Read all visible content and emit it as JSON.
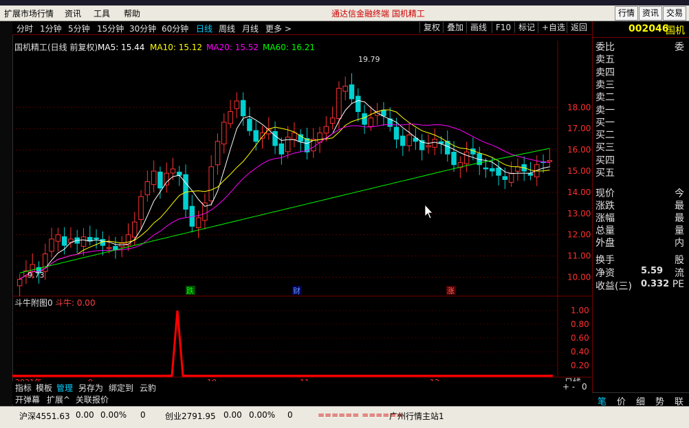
{
  "menu": {
    "items": [
      "扩展市场行情",
      "资讯",
      "工具",
      "帮助"
    ],
    "center_title": "通达信金融终端   国机精工",
    "right_buttons": [
      "行情",
      "资讯",
      "交易"
    ]
  },
  "toolbar": {
    "periods": [
      "分时",
      "1分钟",
      "5分钟",
      "15分钟",
      "30分钟",
      "60分钟",
      "日线",
      "周线",
      "月线",
      "更多 >"
    ],
    "active": "日线",
    "right_buttons": [
      "复权",
      "叠加",
      "画线",
      "F10",
      "标记",
      "+自选",
      "返回"
    ]
  },
  "legend": {
    "name": "国机精工(日线 前复权)",
    "ma5": "MA5: 15.44",
    "ma10": "MA10: 15.12",
    "ma20": "MA20: 15.52",
    "ma60": "MA60: 16.21",
    "colors": {
      "ma5": "#ffffff",
      "ma10": "#ffff00",
      "ma20": "#ff00ff",
      "ma60": "#00ff00"
    }
  },
  "price_axis": [
    "18.00",
    "17.00",
    "16.00",
    "15.00",
    "14.00",
    "13.00",
    "12.00",
    "11.00",
    "10.00"
  ],
  "annotations": {
    "high": "19.79",
    "low": "9.73",
    "markers": [
      "跌",
      "财",
      "涨"
    ]
  },
  "sub_chart": {
    "title": "斗牛附图0",
    "label": "斗牛: 0.00",
    "axis": [
      "1.00",
      "0.80",
      "0.60",
      "0.40",
      "0.20"
    ]
  },
  "date_axis": [
    "2021年",
    "9",
    "10",
    "11",
    "12"
  ],
  "period_label": "日线",
  "bottom_tabs": [
    "指标",
    "模板",
    "管理",
    "另存为",
    "绑定到",
    "云豹"
  ],
  "bottom_tabs2": [
    "开弹幕",
    "扩展^",
    "关联报价"
  ],
  "right_panel": {
    "code": "002046",
    "name": "国机",
    "rows_top": [
      "委比",
      "卖五",
      "卖四",
      "卖三",
      "卖二",
      "卖一",
      "买一",
      "买二",
      "买三",
      "买四",
      "买五"
    ],
    "rows_top_right": [
      "委"
    ],
    "rows_mid": [
      "现价",
      "涨跌",
      "涨幅",
      "总量",
      "外盘"
    ],
    "rows_mid_right": [
      "今",
      "最",
      "最",
      "量",
      "内"
    ],
    "rows_bot": [
      "换手",
      "净资",
      "收益(三)"
    ],
    "rows_bot_vals": [
      "",
      "5.59",
      "0.332"
    ],
    "rows_bot_right": [
      "股",
      "流",
      "PE"
    ],
    "tabs": [
      "笔",
      "价",
      "细",
      "势",
      "联"
    ]
  },
  "status": {
    "sh": "沪深4551.63",
    "sh_chg": "0.00",
    "sh_pct": "0.00%",
    "sh_vol": "0",
    "cy": "创业2791.95",
    "cy_chg": "0.00",
    "cy_pct": "0.00%",
    "cy_vol": "0",
    "bar": "====== ======",
    "station": "广州行情主站1"
  },
  "chart_data": {
    "type": "candlestick",
    "ylim": [
      9.5,
      20.5
    ],
    "closes": [
      9.9,
      10.3,
      10.6,
      10.2,
      11.1,
      11.8,
      12.0,
      11.5,
      11.8,
      11.6,
      11.9,
      11.7,
      11.8,
      11.5,
      11.4,
      11.3,
      11.6,
      12.0,
      12.6,
      13.8,
      14.5,
      15.0,
      14.2,
      14.9,
      15.1,
      14.8,
      13.2,
      12.4,
      12.8,
      13.5,
      15.2,
      16.4,
      17.3,
      17.8,
      18.3,
      17.6,
      16.9,
      16.4,
      16.8,
      17.0,
      16.2,
      15.8,
      16.6,
      16.8,
      16.4,
      15.9,
      16.5,
      16.8,
      17.1,
      17.5,
      18.9,
      19.0,
      18.4,
      17.8,
      17.2,
      17.5,
      17.8,
      17.6,
      17.1,
      16.5,
      16.2,
      16.7,
      16.4,
      16.0,
      16.2,
      16.5,
      16.3,
      15.8,
      15.3,
      15.4,
      15.9,
      15.8,
      15.3,
      15.1,
      15.0,
      14.8,
      14.6,
      14.9,
      15.2,
      15.0,
      14.8,
      15.3,
      15.4,
      15.5
    ]
  }
}
